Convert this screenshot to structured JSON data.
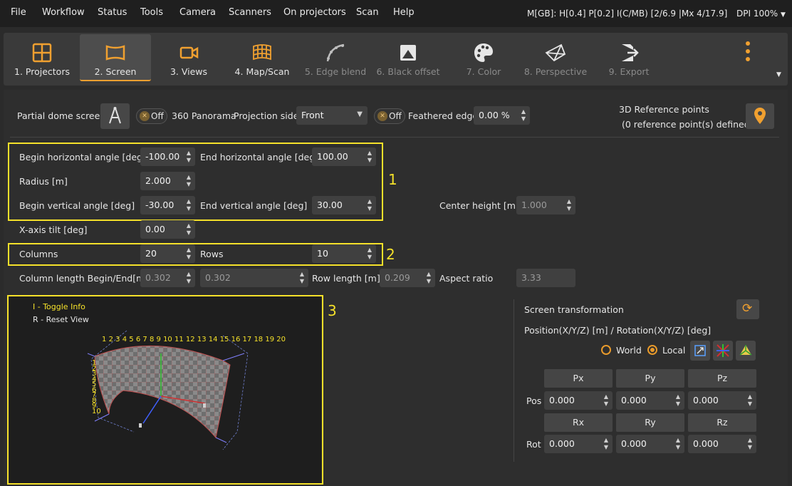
{
  "menu": [
    "File",
    "Workflow",
    "Status",
    "Tools",
    "Camera",
    "Scanners",
    "On projectors",
    "Scan",
    "Help"
  ],
  "status_text": "M[GB]: H[0.4] P[0.2] I(C/MB) [2/6.9 |Mx 4/17.9]",
  "dpi": "DPI 100%",
  "tabs": [
    "1. Projectors",
    "2. Screen",
    "3. Views",
    "4. Map/Scan",
    "5. Edge blend",
    "6. Black offset",
    "7. Color",
    "8. Perspective",
    "9. Export"
  ],
  "active_tab": "2. Screen",
  "accent_color": "#f0a030",
  "top": {
    "partial_dome_label": "Partial dome screen",
    "panorama_toggle": "Off",
    "panorama_label": "360 Panorama",
    "projection_side_label": "Projection side",
    "projection_side_value": "Front",
    "feather_toggle": "Off",
    "feathered_edge_label": "Feathered edge",
    "feathered_edge_value": "0.00 %",
    "ref_points_title": "3D Reference points",
    "ref_points_sub": "(0 reference point(s) defined)"
  },
  "params": {
    "begin_h_label": "Begin horizontal angle [deg]",
    "begin_h": "-100.00",
    "end_h_label": "End horizontal angle [deg]",
    "end_h": "100.00",
    "radius_label": "Radius [m]",
    "radius": "2.000",
    "begin_v_label": "Begin vertical angle [deg]",
    "begin_v": "-30.00",
    "end_v_label": "End vertical angle [deg]",
    "end_v": "30.00",
    "center_height_label": "Center height [m]",
    "center_height": "1.000",
    "xtilt_label": "X-axis tilt [deg]",
    "xtilt": "0.00",
    "columns_label": "Columns",
    "columns": "20",
    "rows_label": "Rows",
    "rows": "10",
    "col_len_label": "Column length Begin/End[m]",
    "col_len_begin": "0.302",
    "col_len_end": "0.302",
    "row_len_label": "Row length [m]",
    "row_len": "0.209",
    "aspect_label": "Aspect ratio",
    "aspect": "3.33"
  },
  "annotations": [
    "1",
    "2",
    "3"
  ],
  "viewport": {
    "info1": "I - Toggle Info",
    "info2": "R - Reset View",
    "col_numbers": [
      "1",
      "2",
      "3",
      "4",
      "5",
      "6",
      "7",
      "8",
      "9",
      "10",
      "11",
      "12",
      "13",
      "14",
      "15",
      "16",
      "17",
      "18",
      "19",
      "20"
    ],
    "row_numbers": [
      "1",
      "2",
      "3",
      "4",
      "5",
      "6",
      "7",
      "8",
      "9",
      "10"
    ]
  },
  "transform": {
    "title": "Screen transformation",
    "subtitle": "Position(X/Y/Z) [m] / Rotation(X/Y/Z) [deg]",
    "world": "World",
    "local": "Local",
    "pos_headers": [
      "Px",
      "Py",
      "Pz"
    ],
    "rot_headers": [
      "Rx",
      "Ry",
      "Rz"
    ],
    "pos_label": "Pos",
    "rot_label": "Rot",
    "pos": [
      "0.000",
      "0.000",
      "0.000"
    ],
    "rot": [
      "0.000",
      "0.000",
      "0.000"
    ]
  }
}
